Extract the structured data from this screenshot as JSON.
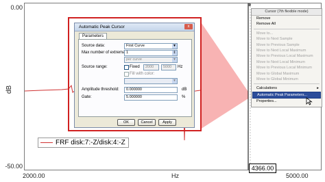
{
  "plot": {
    "y_ticks": [
      "0.00",
      "dB",
      "-50.00"
    ],
    "x_ticks": [
      "2000.00",
      "Hz",
      "5000.00"
    ],
    "cursor_value": "4366.00",
    "legend": "FRF disk:7:-Z/disk:4:-Z",
    "colors": {
      "trace": "#d03030",
      "highlight": "#f59a9a",
      "accent": "#2c4d9a"
    }
  },
  "dialog": {
    "title": "Automatic Peak Cursor",
    "close_label": "x",
    "tab": "Parameters",
    "source_data_label": "Source data:",
    "source_data_value": "First Curve",
    "max_extrema_label": "Max number of extrema:",
    "max_extrema_value": "1",
    "per_curve_value": "per curve",
    "source_range_label": "Source range:",
    "fixed_label": "Fixed",
    "range_from": "2000",
    "range_to": "5000",
    "range_unit": "Hz",
    "fill_label": "Fill with color:",
    "threshold_label": "Amplitude threshold:",
    "threshold_value": "0.000000",
    "threshold_unit": "dB",
    "gate_label": "Gate:",
    "gate_value": "5.000000",
    "gate_unit": "%",
    "ok_label": "OK",
    "cancel_label": "Cancel",
    "apply_label": "Apply"
  },
  "context_menu": {
    "title": "Cursor (7th flexible mode)",
    "items": [
      {
        "label": "Remove",
        "state": "enabled"
      },
      {
        "label": "Remove All",
        "state": "enabled"
      },
      {
        "label": "Move to...",
        "state": "disabled"
      },
      {
        "label": "Move to Next Sample",
        "state": "disabled"
      },
      {
        "label": "Move to Previous Sample",
        "state": "disabled"
      },
      {
        "label": "Move to Next Local Maximum",
        "state": "disabled"
      },
      {
        "label": "Move to Previous Local Maximum",
        "state": "disabled"
      },
      {
        "label": "Move to Next Local Minimum",
        "state": "disabled"
      },
      {
        "label": "Move to Previous Local Minimum",
        "state": "disabled"
      },
      {
        "label": "Move to Global Maximum",
        "state": "disabled"
      },
      {
        "label": "Move to Global Minimum",
        "state": "disabled"
      },
      {
        "label": "Calculations",
        "state": "enabled",
        "submenu": "▸"
      },
      {
        "label": "Automatic Peak Parameters...",
        "state": "highlighted"
      },
      {
        "label": "Properties...",
        "state": "enabled"
      }
    ]
  }
}
